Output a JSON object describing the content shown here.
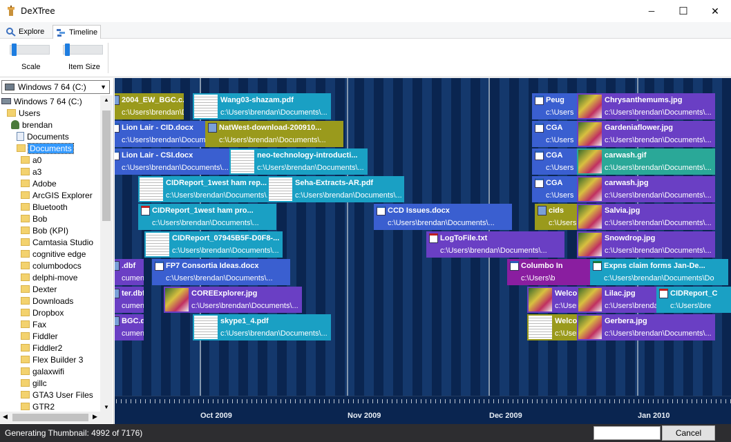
{
  "window": {
    "title": "DeXTree",
    "minimize_glyph": "─",
    "maximize_glyph": "☐",
    "close_glyph": "✕"
  },
  "tabs": [
    {
      "label": "Explore",
      "icon": "magnifier-icon"
    },
    {
      "label": "Timeline",
      "icon": "timeline-icon",
      "active": true
    }
  ],
  "ribbon": {
    "scale_label": "Scale",
    "item_size_label": "Item Size",
    "scale_level": 0.05,
    "item_size_level": 0.05
  },
  "sidebar": {
    "drive": "Windows 7 64 (C:)",
    "tree": [
      {
        "label": "Windows 7 64 (C:)",
        "icon": "drive-icon",
        "level": 0
      },
      {
        "label": "Users",
        "icon": "folder-icon",
        "level": 1
      },
      {
        "label": "brendan",
        "icon": "user-icon",
        "level": 2
      },
      {
        "label": "Documents",
        "icon": "documents-icon",
        "level": 3
      },
      {
        "label": "Documents",
        "icon": "folder-icon",
        "level": 3,
        "selected": true
      },
      {
        "label": "a0",
        "icon": "folder-icon",
        "level": 4
      },
      {
        "label": "a3",
        "icon": "folder-icon",
        "level": 4
      },
      {
        "label": "Adobe",
        "icon": "folder-icon",
        "level": 4
      },
      {
        "label": "ArcGIS Explorer",
        "icon": "folder-icon",
        "level": 4
      },
      {
        "label": "Bluetooth",
        "icon": "folder-icon",
        "level": 4
      },
      {
        "label": "Bob",
        "icon": "folder-icon",
        "level": 4
      },
      {
        "label": "Bob (KPI)",
        "icon": "folder-icon",
        "level": 4
      },
      {
        "label": "Camtasia Studio",
        "icon": "folder-icon",
        "level": 4
      },
      {
        "label": "cognitive edge",
        "icon": "folder-icon",
        "level": 4
      },
      {
        "label": "columbodocs",
        "icon": "folder-icon",
        "level": 4
      },
      {
        "label": "delphi-move",
        "icon": "folder-icon",
        "level": 4
      },
      {
        "label": "Dexter",
        "icon": "folder-icon",
        "level": 4
      },
      {
        "label": "Downloads",
        "icon": "folder-icon",
        "level": 4
      },
      {
        "label": "Dropbox",
        "icon": "folder-icon",
        "level": 4
      },
      {
        "label": "Fax",
        "icon": "folder-icon",
        "level": 4
      },
      {
        "label": "Fiddler",
        "icon": "folder-icon",
        "level": 4
      },
      {
        "label": "Fiddler2",
        "icon": "folder-icon",
        "level": 4
      },
      {
        "label": "Flex Builder 3",
        "icon": "folder-icon",
        "level": 4
      },
      {
        "label": "galaxwifi",
        "icon": "folder-icon",
        "level": 4
      },
      {
        "label": "gillc",
        "icon": "folder-icon",
        "level": 4
      },
      {
        "label": "GTA3 User Files",
        "icon": "folder-icon",
        "level": 4
      },
      {
        "label": "GTR2",
        "icon": "folder-icon",
        "level": 4
      }
    ]
  },
  "timeline": {
    "months": [
      "Oct 2009",
      "Nov 2009",
      "Dec 2009",
      "Jan 2010"
    ],
    "path": "c:\\Users\\brendan\\Documents\\...",
    "items": [
      {
        "name": "2004_EW_BGC.c...",
        "path": "c:\\Users\\brendan\\Documents\\...",
        "color": "#9a9a1c",
        "icon": "file-icon"
      },
      {
        "name": "Wang03-shazam.pdf",
        "path": "c:\\Users\\brendan\\Documents\\...",
        "color": "#1aa0c4",
        "icon": "pdf-thumbnail"
      },
      {
        "name": "Lion Lair - CID.docx",
        "path": "c:\\Users\\brendan\\Documents\\...",
        "color": "#3a5fd0",
        "icon": "word-doc-icon"
      },
      {
        "name": "NatWest-download-200910...",
        "path": "c:\\Users\\brendan\\Documents\\...",
        "color": "#9a9a1c",
        "icon": "file-icon"
      },
      {
        "name": "Lion Lair - CSI.docx",
        "path": "c:\\Users\\brendan\\Documents\\...",
        "color": "#3a5fd0",
        "icon": "word-doc-icon"
      },
      {
        "name": "neo-technology-introducti...",
        "path": "c:\\Users\\brendan\\Documents\\...",
        "color": "#1aa0c4",
        "icon": "pdf-thumbnail"
      },
      {
        "name": "CIDReport_1west ham rep...",
        "path": "c:\\Users\\brendan\\Documents\\...",
        "color": "#1aa0c4",
        "icon": "pdf-thumbnail"
      },
      {
        "name": "Seha-Extracts-AR.pdf",
        "path": "c:\\Users\\brendan\\Documents\\...",
        "color": "#1aa0c4",
        "icon": "pdf-thumbnail"
      },
      {
        "name": "CIDReport_1west ham pro...",
        "path": "c:\\Users\\brendan\\Documents\\...",
        "color": "#1aa0c4",
        "icon": "pdf-icon"
      },
      {
        "name": "CCD Issues.docx",
        "path": "c:\\Users\\brendan\\Documents\\...",
        "color": "#3a5fd0",
        "icon": "word-doc-icon"
      },
      {
        "name": "CIDReport_07945B5F-D0F8-...",
        "path": "c:\\Users\\brendan\\Documents\\...",
        "color": "#1aa0c4",
        "icon": "pdf-thumbnail"
      },
      {
        "name": "LogToFile.txt",
        "path": "c:\\Users\\brendan\\Documents\\...",
        "color": "#6a3fc4",
        "icon": "text-file-icon"
      },
      {
        "name": "FP7 Consortia Ideas.docx",
        "path": "c:\\Users\\brendan\\Documents\\...",
        "color": "#3a5fd0",
        "icon": "word-doc-icon"
      },
      {
        "name": "COREExplorer.jpg",
        "path": "c:\\Users\\brendan\\Documents\\...",
        "color": "#6a3fc4",
        "icon": "image-thumbnail"
      },
      {
        "name": "skype1_4.pdf",
        "path": "c:\\Users\\brendan\\Documents\\...",
        "color": "#1aa0c4",
        "icon": "pdf-thumbnail"
      },
      {
        "name": "Peug",
        "path": "c:\\Users",
        "color": "#3a5fd0",
        "icon": "word-doc-icon"
      },
      {
        "name": "CGA",
        "path": "c:\\Users",
        "color": "#3a5fd0",
        "icon": "word-doc-icon"
      },
      {
        "name": "CGA",
        "path": "c:\\Users",
        "color": "#3a5fd0",
        "icon": "word-doc-icon"
      },
      {
        "name": "CGA",
        "path": "c:\\Users",
        "color": "#3a5fd0",
        "icon": "word-doc-icon"
      },
      {
        "name": "cids",
        "path": "c:\\Users",
        "color": "#9a9a1c",
        "icon": "file-icon"
      },
      {
        "name": "Chrysanthemums.jpg",
        "path": "c:\\Users\\brendan\\Documents\\...",
        "color": "#6a3fc4",
        "icon": "image-thumbnail"
      },
      {
        "name": "Gardeniaflower.jpg",
        "path": "c:\\Users\\brendan\\Documents\\...",
        "color": "#6a3fc4",
        "icon": "image-thumbnail"
      },
      {
        "name": "carwash.gif",
        "path": "c:\\Users\\brendan\\Documents\\...",
        "color": "#2aa898",
        "icon": "image-thumbnail"
      },
      {
        "name": "carwash.jpg",
        "path": "c:\\Users\\brendan\\Documents\\...",
        "color": "#6a3fc4",
        "icon": "image-thumbnail"
      },
      {
        "name": "Salvia.jpg",
        "path": "c:\\Users\\brendan\\Documents\\...",
        "color": "#6a3fc4",
        "icon": "image-thumbnail"
      },
      {
        "name": "Snowdrop.jpg",
        "path": "c:\\Users\\brendan\\Documents\\...",
        "color": "#6a3fc4",
        "icon": "image-thumbnail"
      },
      {
        "name": "Columbo In",
        "path": "c:\\Users\\b",
        "color": "#8a1ea0",
        "icon": "word-doc-icon"
      },
      {
        "name": "Expns claim forms Jan-De...",
        "path": "c:\\Users\\brendan\\Documents\\Do",
        "color": "#1aa0c4",
        "icon": "spreadsheet-icon"
      },
      {
        "name": "Welco",
        "path": "c:\\Users",
        "color": "#6a3fc4",
        "icon": "image-thumbnail"
      },
      {
        "name": "Lilac.jpg",
        "path": "c:\\Users\\brenda",
        "color": "#6a3fc4",
        "icon": "image-thumbnail"
      },
      {
        "name": "CIDReport_C",
        "path": "c:\\Users\\bre",
        "color": "#1aa0c4",
        "icon": "pdf-icon"
      },
      {
        "name": "Welco",
        "path": "c:\\Users",
        "color": "#9a9a1c",
        "icon": "document-thumbnail"
      },
      {
        "name": "Gerbera.jpg",
        "path": "c:\\Users\\brendan\\Documents\\...",
        "color": "#6a3fc4",
        "icon": "image-thumbnail"
      },
      {
        "name": ".dbf",
        "path": "cuments\\...",
        "color": "#6a3fc4",
        "icon": "file-icon"
      },
      {
        "name": "ter.dbf",
        "path": "cuments\\...",
        "color": "#6a3fc4",
        "icon": "file-icon"
      },
      {
        "name": "BGC.d...",
        "path": "cuments\\...",
        "color": "#6a3fc4",
        "icon": "file-icon"
      }
    ]
  },
  "status": {
    "text": "Generating Thumbnail: 4992 of 7176)",
    "cancel_label": "Cancel"
  }
}
